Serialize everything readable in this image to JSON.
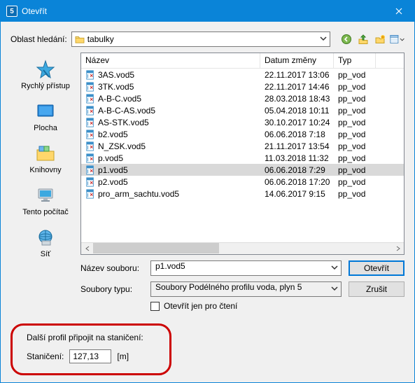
{
  "window": {
    "title": "Otevřít",
    "app_icon_char": "5"
  },
  "lookin": {
    "label": "Oblast hledání:",
    "value": "tabulky"
  },
  "toolbar_icons": [
    "back-icon",
    "up-icon",
    "newfolder-icon",
    "views-icon"
  ],
  "sidebar": {
    "items": [
      {
        "id": "quick",
        "label": "Rychlý přístup"
      },
      {
        "id": "desktop",
        "label": "Plocha"
      },
      {
        "id": "libs",
        "label": "Knihovny"
      },
      {
        "id": "thispc",
        "label": "Tento počítač"
      },
      {
        "id": "network",
        "label": "Síť"
      }
    ]
  },
  "columns": {
    "name": "Název",
    "date": "Datum změny",
    "type": "Typ"
  },
  "files": [
    {
      "name": "3AS.vod5",
      "date": "22.11.2017 13:06",
      "type": "pp_vod",
      "selected": false
    },
    {
      "name": "3TK.vod5",
      "date": "22.11.2017 14:46",
      "type": "pp_vod",
      "selected": false
    },
    {
      "name": "A-B-C.vod5",
      "date": "28.03.2018 18:43",
      "type": "pp_vod",
      "selected": false
    },
    {
      "name": "A-B-C-AS.vod5",
      "date": "05.04.2018 10:11",
      "type": "pp_vod",
      "selected": false
    },
    {
      "name": "AS-STK.vod5",
      "date": "30.10.2017 10:24",
      "type": "pp_vod",
      "selected": false
    },
    {
      "name": "b2.vod5",
      "date": "06.06.2018 7:18",
      "type": "pp_vod",
      "selected": false
    },
    {
      "name": "N_ZSK.vod5",
      "date": "21.11.2017 13:54",
      "type": "pp_vod",
      "selected": false
    },
    {
      "name": "p.vod5",
      "date": "11.03.2018 11:32",
      "type": "pp_vod",
      "selected": false
    },
    {
      "name": "p1.vod5",
      "date": "06.06.2018 7:29",
      "type": "pp_vod",
      "selected": true
    },
    {
      "name": "p2.vod5",
      "date": "06.06.2018 17:20",
      "type": "pp_vod",
      "selected": false
    },
    {
      "name": "pro_arm_sachtu.vod5",
      "date": "14.06.2017 9:15",
      "type": "pp_vod",
      "selected": false
    }
  ],
  "form": {
    "filename_label": "Název souboru:",
    "filename_value": "p1.vod5",
    "filter_label": "Soubory typu:",
    "filter_value": "Soubory Podélného profilu voda, plyn 5",
    "readonly_label": "Otevřít jen pro čtení",
    "open_btn": "Otevřít",
    "cancel_btn": "Zrušit"
  },
  "station": {
    "group_label": "Další profil připojit na staničení:",
    "field_label": "Staničení:",
    "value": "127,13",
    "unit": "[m]"
  }
}
